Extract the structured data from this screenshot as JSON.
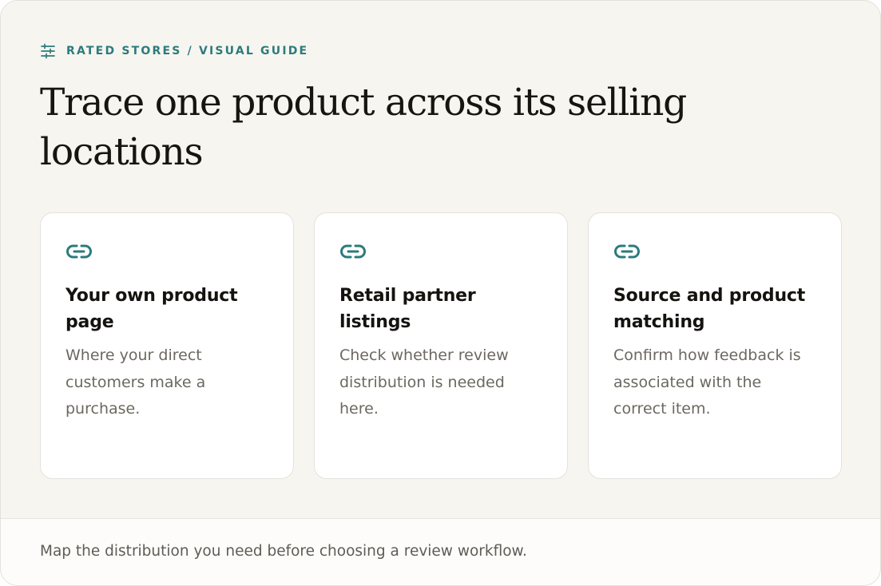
{
  "eyebrow": {
    "icon": "sliders-icon",
    "label": "RATED STORES / VISUAL GUIDE"
  },
  "headline": "Trace one product across its selling locations",
  "accent_color": "#2c7b7c",
  "tiles": [
    {
      "icon": "link-icon",
      "title": "Your own product page",
      "description": "Where your direct customers make a purchase."
    },
    {
      "icon": "link-icon",
      "title": "Retail partner listings",
      "description": "Check whether review distribution is needed here."
    },
    {
      "icon": "link-icon",
      "title": "Source and product matching",
      "description": "Confirm how feedback is associated with the correct item."
    }
  ],
  "footer": {
    "note": "Map the distribution you need before choosing a review workflow."
  }
}
